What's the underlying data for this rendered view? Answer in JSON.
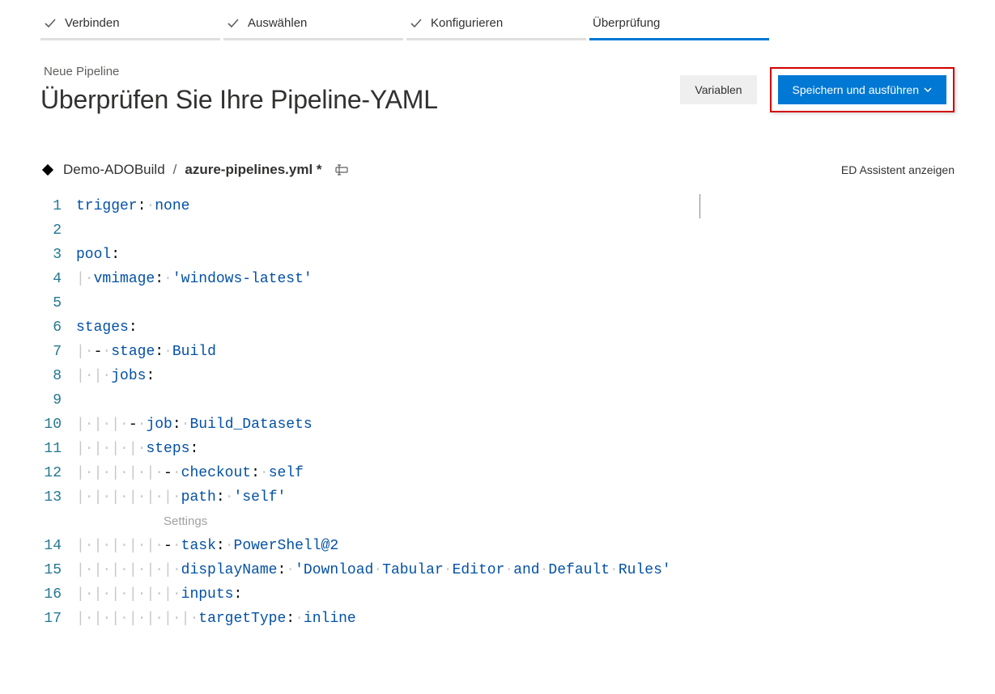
{
  "stepper": {
    "steps": [
      {
        "label": "Verbinden",
        "done": true
      },
      {
        "label": "Auswählen",
        "done": true
      },
      {
        "label": "Konfigurieren",
        "done": true
      },
      {
        "label": "Überprüfung",
        "active": true
      }
    ]
  },
  "page": {
    "subtitle": "Neue Pipeline",
    "title": "Überprüfen Sie Ihre Pipeline-YAML"
  },
  "buttons": {
    "variables": "Variablen",
    "save_run": "Speichern und ausführen"
  },
  "breadcrumb": {
    "repo": "Demo-ADOBuild",
    "sep": "/",
    "file": "azure-pipelines.yml *"
  },
  "assistant": {
    "label": "ED Assistent anzeigen"
  },
  "editor": {
    "settings_label": "Settings",
    "lines": [
      {
        "n": 1,
        "segments": [
          {
            "t": "trigger",
            "c": "key"
          },
          {
            "t": ":",
            "c": "punct"
          },
          {
            "t": "·",
            "c": "dot"
          },
          {
            "t": "none",
            "c": "val"
          }
        ]
      },
      {
        "n": 2,
        "segments": []
      },
      {
        "n": 3,
        "segments": [
          {
            "t": "pool",
            "c": "key"
          },
          {
            "t": ":",
            "c": "punct"
          }
        ]
      },
      {
        "n": 4,
        "segments": [
          {
            "indent": 1
          },
          {
            "t": "vmimage",
            "c": "key"
          },
          {
            "t": ":",
            "c": "punct"
          },
          {
            "t": "·",
            "c": "dot"
          },
          {
            "t": "'windows-latest'",
            "c": "str"
          }
        ]
      },
      {
        "n": 5,
        "segments": []
      },
      {
        "n": 6,
        "segments": [
          {
            "t": "stages",
            "c": "key"
          },
          {
            "t": ":",
            "c": "punct"
          }
        ]
      },
      {
        "n": 7,
        "segments": [
          {
            "indent": 1
          },
          {
            "t": "-",
            "c": "punct"
          },
          {
            "t": "·",
            "c": "dot"
          },
          {
            "t": "stage",
            "c": "key"
          },
          {
            "t": ":",
            "c": "punct"
          },
          {
            "t": "·",
            "c": "dot"
          },
          {
            "t": "Build",
            "c": "val"
          }
        ]
      },
      {
        "n": 8,
        "segments": [
          {
            "indent": 2
          },
          {
            "t": "jobs",
            "c": "key"
          },
          {
            "t": ":",
            "c": "punct"
          }
        ]
      },
      {
        "n": 9,
        "segments": []
      },
      {
        "n": 10,
        "segments": [
          {
            "indent": 3
          },
          {
            "t": "-",
            "c": "punct"
          },
          {
            "t": "·",
            "c": "dot"
          },
          {
            "t": "job",
            "c": "key"
          },
          {
            "t": ":",
            "c": "punct"
          },
          {
            "t": "·",
            "c": "dot"
          },
          {
            "t": "Build_Datasets",
            "c": "val"
          }
        ]
      },
      {
        "n": 11,
        "segments": [
          {
            "indent": 4
          },
          {
            "t": "steps",
            "c": "key"
          },
          {
            "t": ":",
            "c": "punct"
          }
        ]
      },
      {
        "n": 12,
        "segments": [
          {
            "indent": 5
          },
          {
            "t": "-",
            "c": "punct"
          },
          {
            "t": "·",
            "c": "dot"
          },
          {
            "t": "checkout",
            "c": "key"
          },
          {
            "t": ":",
            "c": "punct"
          },
          {
            "t": "·",
            "c": "dot"
          },
          {
            "t": "self",
            "c": "val"
          }
        ]
      },
      {
        "n": 13,
        "segments": [
          {
            "indent": 6
          },
          {
            "t": "path",
            "c": "key"
          },
          {
            "t": ":",
            "c": "punct"
          },
          {
            "t": "·",
            "c": "dot"
          },
          {
            "t": "'self'",
            "c": "str"
          }
        ]
      },
      {
        "n": 14,
        "segments": [
          {
            "indent": 5
          },
          {
            "t": "-",
            "c": "punct"
          },
          {
            "t": "·",
            "c": "dot"
          },
          {
            "t": "task",
            "c": "key"
          },
          {
            "t": ":",
            "c": "punct"
          },
          {
            "t": "·",
            "c": "dot"
          },
          {
            "t": "PowerShell@2",
            "c": "val"
          }
        ],
        "annotation": "settings"
      },
      {
        "n": 15,
        "segments": [
          {
            "indent": 6
          },
          {
            "t": "displayName",
            "c": "key"
          },
          {
            "t": ":",
            "c": "punct"
          },
          {
            "t": "·",
            "c": "dot"
          },
          {
            "t": "'Download·Tabular·Editor·and·Default·Rules'",
            "c": "str"
          }
        ]
      },
      {
        "n": 16,
        "segments": [
          {
            "indent": 6
          },
          {
            "t": "inputs",
            "c": "key"
          },
          {
            "t": ":",
            "c": "punct"
          }
        ]
      },
      {
        "n": 17,
        "segments": [
          {
            "indent": 7
          },
          {
            "t": "targetType",
            "c": "key"
          },
          {
            "t": ":",
            "c": "punct"
          },
          {
            "t": "·",
            "c": "dot"
          },
          {
            "t": "inline",
            "c": "val"
          }
        ]
      }
    ]
  }
}
